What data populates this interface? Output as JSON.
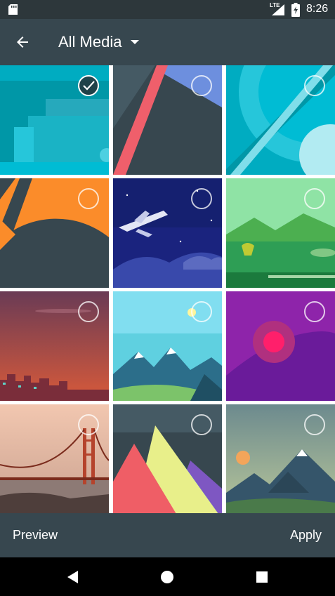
{
  "status_bar": {
    "network": "LTE",
    "time": "8:26",
    "icons": [
      "sd-card-icon",
      "signal-icon",
      "battery-charging-icon"
    ]
  },
  "app_bar": {
    "title": "All Media",
    "icons": [
      "back-arrow-icon",
      "dropdown-arrow-icon"
    ]
  },
  "grid": {
    "columns": 3,
    "tiles": [
      {
        "name": "wallpaper-teal-steps",
        "selected": true
      },
      {
        "name": "wallpaper-slate-red-stripe",
        "selected": false
      },
      {
        "name": "wallpaper-cyan-circle",
        "selected": false
      },
      {
        "name": "wallpaper-orange-dark-arcs",
        "selected": false
      },
      {
        "name": "wallpaper-night-airplane",
        "selected": false
      },
      {
        "name": "wallpaper-green-landscape",
        "selected": false
      },
      {
        "name": "wallpaper-red-dusk-city",
        "selected": false
      },
      {
        "name": "wallpaper-sky-mountains",
        "selected": false
      },
      {
        "name": "wallpaper-purple-sun",
        "selected": false
      },
      {
        "name": "wallpaper-golden-gate",
        "selected": false
      },
      {
        "name": "wallpaper-pastel-triangles",
        "selected": false
      },
      {
        "name": "wallpaper-mountain-sunset",
        "selected": false
      }
    ]
  },
  "bottom_bar": {
    "preview_label": "Preview",
    "apply_label": "Apply"
  },
  "nav_bar": {
    "icons": [
      "nav-back-icon",
      "nav-home-icon",
      "nav-recents-icon"
    ]
  },
  "colors": {
    "status_bar": "#2d373b",
    "app_bar": "#37474f",
    "nav_bar": "#000000",
    "text": "#ffffff"
  }
}
